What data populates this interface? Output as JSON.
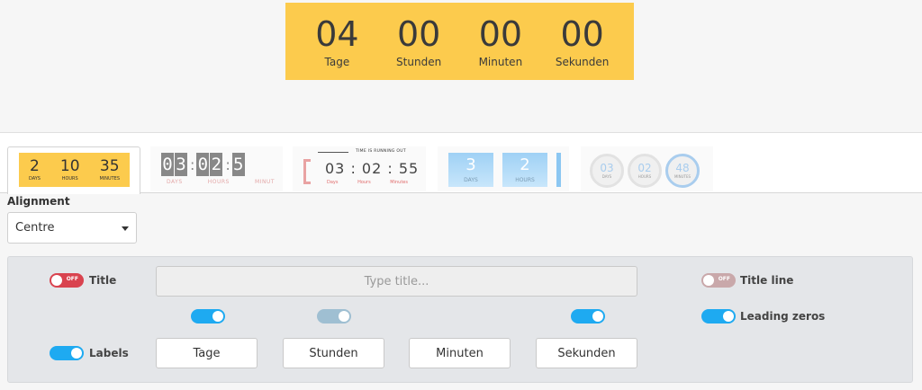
{
  "preview": {
    "units": [
      {
        "value": "04",
        "label": "Tage"
      },
      {
        "value": "00",
        "label": "Stunden"
      },
      {
        "value": "00",
        "label": "Minuten"
      },
      {
        "value": "00",
        "label": "Sekunden"
      }
    ],
    "background": "#fccb4d"
  },
  "templates": {
    "t1": {
      "units": [
        {
          "value": "2",
          "label": "DAYS"
        },
        {
          "value": "10",
          "label": "HOURS"
        },
        {
          "value": "35",
          "label": "MINUTES"
        }
      ]
    },
    "t2": {
      "digits": [
        "0",
        "3",
        "0",
        "2",
        "5"
      ],
      "labels": [
        "DAYS",
        "HOURS",
        "MINUT"
      ]
    },
    "t3": {
      "header": "TIME IS RUNNING OUT",
      "time": "03 : 02 : 55",
      "labels": [
        "Days",
        "Hours",
        "Minutes"
      ]
    },
    "t4": {
      "units": [
        {
          "value": "3",
          "label": "DAYS"
        },
        {
          "value": "2",
          "label": "HOURS"
        }
      ]
    },
    "t5": {
      "units": [
        {
          "value": "03",
          "label": "DAYS"
        },
        {
          "value": "02",
          "label": "HOURS"
        },
        {
          "value": "48",
          "label": "MINUTES"
        }
      ]
    }
  },
  "alignment": {
    "label": "Alignment",
    "value": "Centre"
  },
  "settings": {
    "title_label": "Title",
    "title_toggle_text": "OFF",
    "title_placeholder": "Type title...",
    "title_line_label": "Title line",
    "title_line_toggle_text": "OFF",
    "leading_zeros_label": "Leading zeros",
    "labels_label": "Labels",
    "unit_labels": [
      "Tage",
      "Stunden",
      "Minuten",
      "Sekunden"
    ]
  },
  "colors": {
    "accent": "#1eaaf1",
    "off": "#d9434f",
    "preview_bg": "#fccb4d"
  }
}
